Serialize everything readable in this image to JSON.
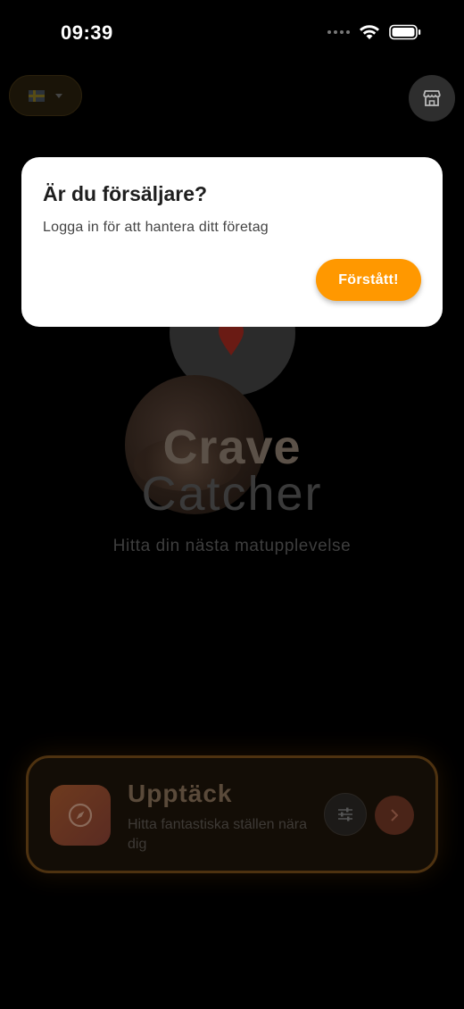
{
  "status_bar": {
    "time": "09:39",
    "icons": [
      "signal-icon",
      "wifi-icon",
      "battery-icon"
    ]
  },
  "header": {
    "language_flag": "sweden-flag-icon",
    "store_icon": "store-icon"
  },
  "logo": {
    "title_line1": "Crave",
    "title_line2": "Catcher",
    "tagline": "Hitta din nästa matupplevelse"
  },
  "discover_card": {
    "title": "Upptäck",
    "subtitle": "Hitta fantastiska ställen nära dig",
    "icon": "compass-icon",
    "filter_icon": "sliders-icon",
    "arrow_icon": "chevron-right-icon"
  },
  "dialog": {
    "title": "Är du försäljare?",
    "body": "Logga in för att hantera ditt företag",
    "button_label": "Förstått!"
  },
  "colors": {
    "accent": "#ff9800",
    "background": "#000000",
    "dialog_background": "#ffffff"
  }
}
